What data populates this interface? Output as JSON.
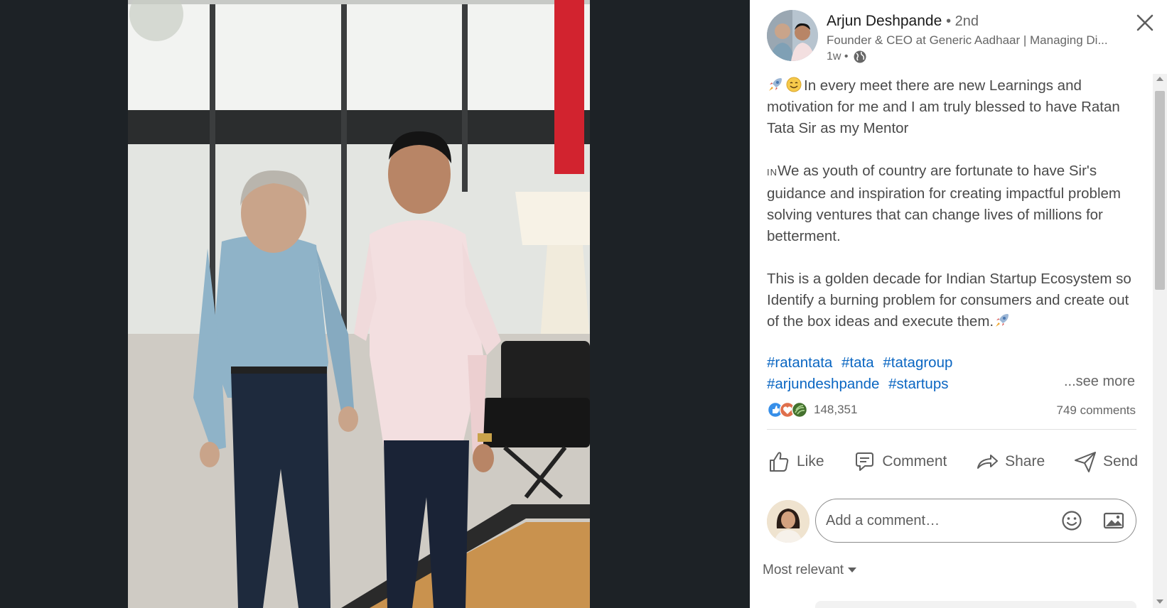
{
  "post": {
    "author": {
      "name": "Arjun Deshpande",
      "degree": "• 2nd",
      "headline": "Founder & CEO at Generic Aadhaar | Managing Di...",
      "time": "1w •",
      "visibility_icon": "globe-icon"
    },
    "body": {
      "paragraph1": "In every meet there are new Learnings and motivation for me and I am truly blessed to have Ratan Tata Sir as my Mentor",
      "paragraph1_emojis": [
        "rocket-emoji",
        "smile-emoji"
      ],
      "flag": "IN",
      "paragraph2": "We as youth of country are fortunate to have Sir's guidance and inspiration for creating impactful problem solving ventures that can change lives of millions for betterment.",
      "paragraph3": "This is a golden decade for Indian Startup Ecosystem so Identify a burning problem for consumers and create out of the box ideas and execute them.",
      "paragraph3_emoji": "rocket-emoji"
    },
    "hashtags": [
      "#ratantata",
      "#tata",
      "#tatagroup",
      "#arjundeshpande",
      "#startups"
    ],
    "see_more": "...see more",
    "reactions": {
      "icons": [
        "like-reaction-icon",
        "love-reaction-icon",
        "support-reaction-icon"
      ],
      "count": "148,351"
    },
    "comments_count": "749 comments",
    "actions": {
      "like": "Like",
      "comment": "Comment",
      "share": "Share",
      "send": "Send"
    },
    "comment_box": {
      "placeholder": "Add a comment…"
    },
    "sort": {
      "label": "Most relevant"
    }
  },
  "colors": {
    "viewer_background": "#1d2226",
    "link_blue": "#0a66c2",
    "text_secondary": "#666666",
    "text_body": "#4a4a4a"
  }
}
